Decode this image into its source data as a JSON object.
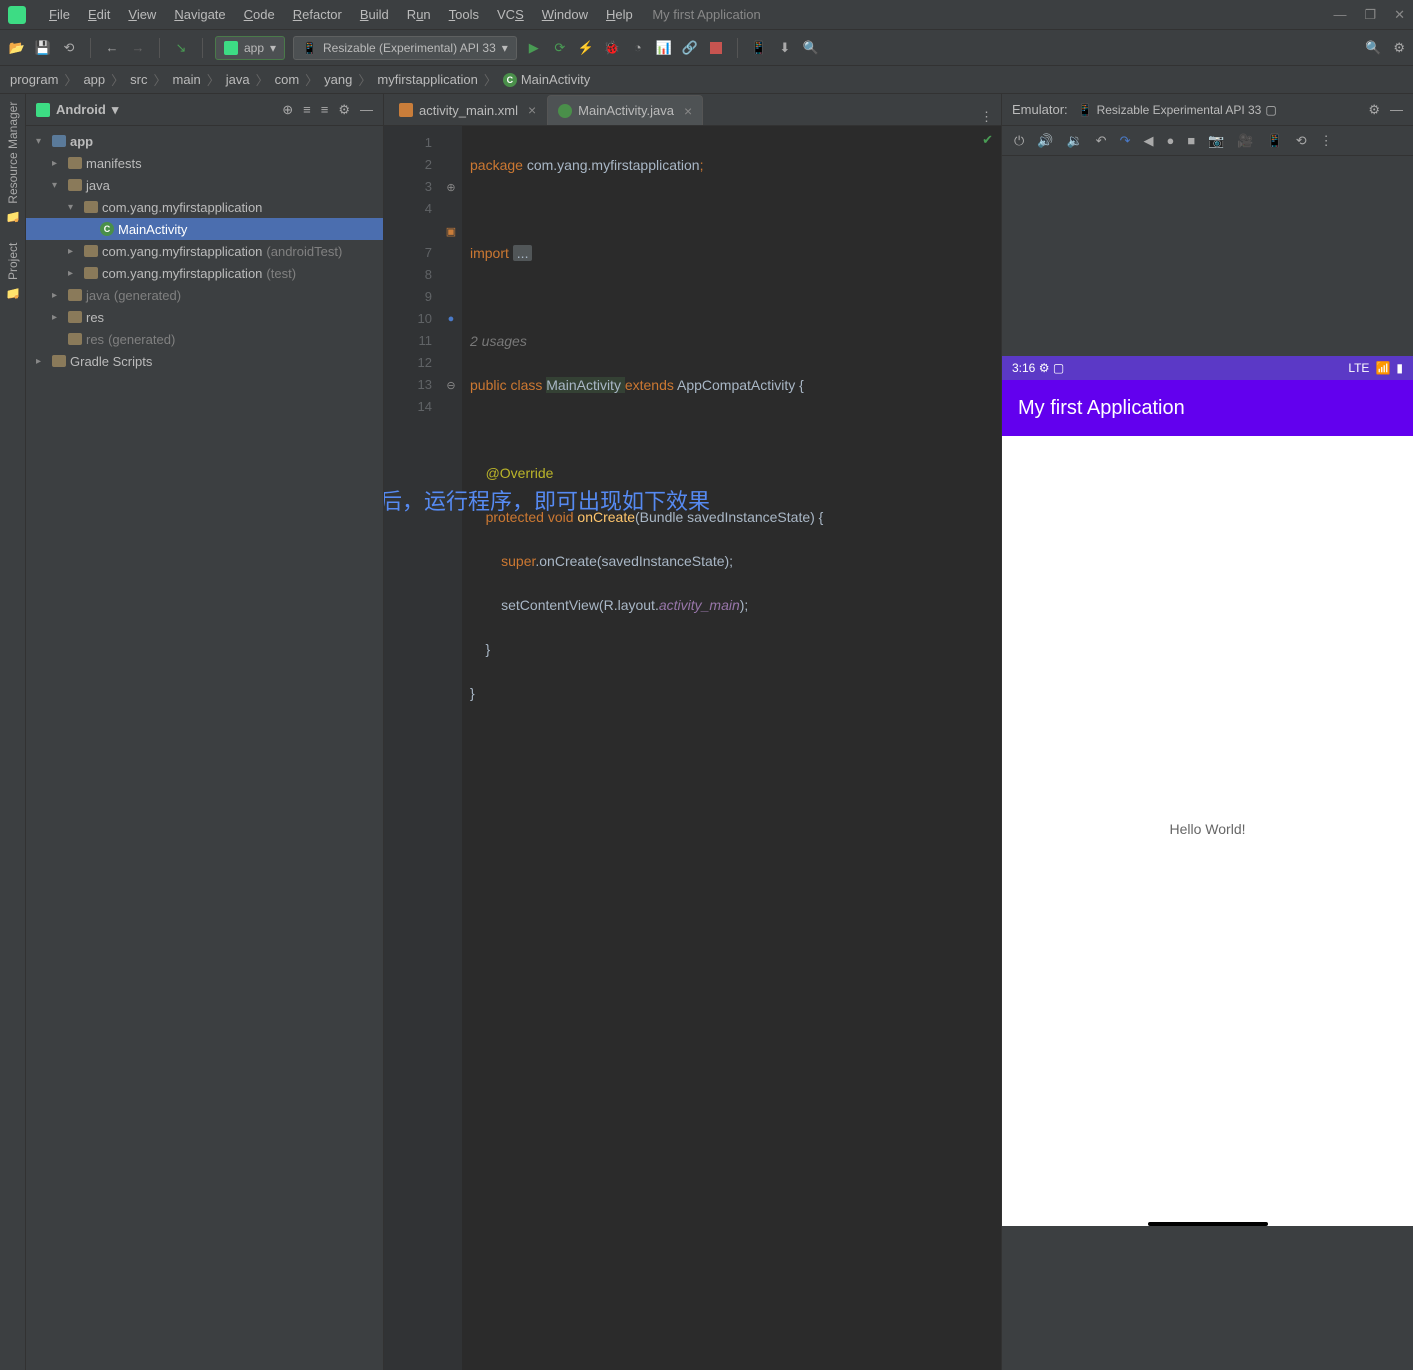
{
  "window": {
    "title": "My first Application"
  },
  "menu": {
    "items": [
      "File",
      "Edit",
      "View",
      "Navigate",
      "Code",
      "Refactor",
      "Build",
      "Run",
      "Tools",
      "VCS",
      "Window",
      "Help"
    ]
  },
  "toolbar": {
    "config_app": "app",
    "device": "Resizable (Experimental) API 33"
  },
  "breadcrumb": [
    "program",
    "app",
    "src",
    "main",
    "java",
    "com",
    "yang",
    "myfirstapplication",
    "MainActivity"
  ],
  "sidebar": {
    "title": "Android",
    "tree": [
      {
        "depth": 0,
        "arrow": "▾",
        "icon": "mod",
        "label": "app",
        "bold": true
      },
      {
        "depth": 1,
        "arrow": "▸",
        "icon": "folder",
        "label": "manifests"
      },
      {
        "depth": 1,
        "arrow": "▾",
        "icon": "folder",
        "label": "java"
      },
      {
        "depth": 2,
        "arrow": "▾",
        "icon": "folder",
        "label": "com.yang.myfirstapplication"
      },
      {
        "depth": 3,
        "arrow": "",
        "icon": "class",
        "label": "MainActivity",
        "sel": true
      },
      {
        "depth": 2,
        "arrow": "▸",
        "icon": "folder",
        "label": "com.yang.myfirstapplication",
        "suffix": "(androidTest)"
      },
      {
        "depth": 2,
        "arrow": "▸",
        "icon": "folder",
        "label": "com.yang.myfirstapplication",
        "suffix": "(test)"
      },
      {
        "depth": 1,
        "arrow": "▸",
        "icon": "folder",
        "label": "java",
        "suffix": "(generated)",
        "gray": true
      },
      {
        "depth": 1,
        "arrow": "▸",
        "icon": "folder",
        "label": "res"
      },
      {
        "depth": 1,
        "arrow": "",
        "icon": "folder",
        "label": "res",
        "suffix": "(generated)",
        "gray": true
      },
      {
        "depth": 0,
        "arrow": "▸",
        "icon": "gradle",
        "label": "Gradle Scripts"
      }
    ]
  },
  "tabs": [
    {
      "label": "activity_main.xml",
      "icon": "xml",
      "active": false
    },
    {
      "label": "MainActivity.java",
      "icon": "java",
      "active": true
    }
  ],
  "code": {
    "lines": [
      "1",
      "2",
      "3",
      "4",
      "",
      "7",
      "8",
      "9",
      "10",
      "11",
      "12",
      "13",
      "14"
    ],
    "usages": "2 usages",
    "package_kw": "package",
    "package_name": " com.yang.myfirstapplication",
    "import_kw": "import",
    "import_dots": "...",
    "l7_public": "public ",
    "l7_class": "class ",
    "l7_name": "MainActivity ",
    "l7_extends": "extends ",
    "l7_parent": "AppCompatActivity",
    "l9_ann": "@Override",
    "l10_prot": "protected ",
    "l10_void": "void ",
    "l10_fn": "onCreate",
    "l10_sig": "(Bundle savedInstanceState)",
    "l11_super": "super",
    "l11_rest": ".onCreate(savedInstanceState);",
    "l12_set": "setContentView(R.layout.",
    "l12_ref": "activity_main",
    "l12_end": ");",
    "l13": "    }",
    "l14": "}"
  },
  "overlay_text": "在开启虚拟设备之后，运行程序，即可出现如下效果",
  "emulator": {
    "label": "Emulator:",
    "device": "Resizable Experimental API 33",
    "status_time": "3:16",
    "status_net": "LTE",
    "app_title": "My first Application",
    "body_text": "Hello World!"
  },
  "left_tabs": {
    "rm": "Resource Manager",
    "prj": "Project"
  }
}
